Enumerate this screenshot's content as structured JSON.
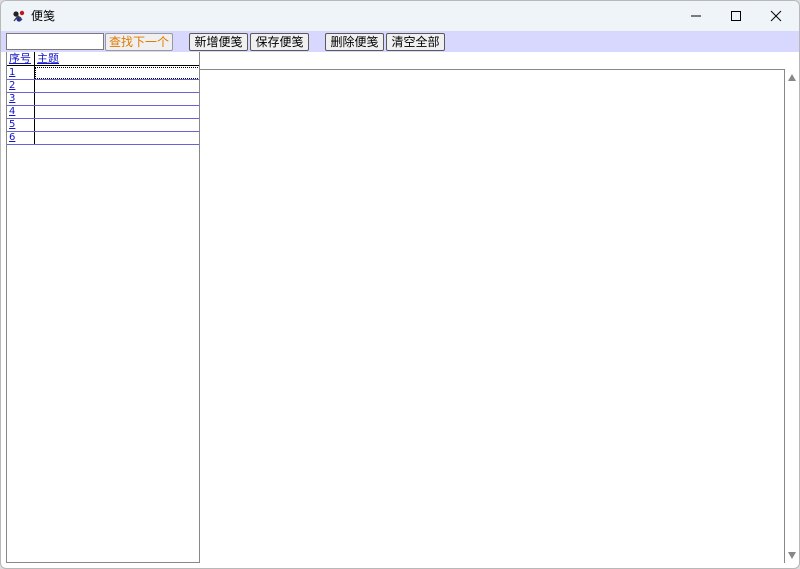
{
  "window": {
    "title": "便笺",
    "icon": "app-notes-icon",
    "controls": [
      "minimize-icon",
      "maximize-icon",
      "close-icon"
    ]
  },
  "toolbar": {
    "search_value": "",
    "find_next_label": "查找下一个",
    "new_note_label": "新增便笺",
    "save_note_label": "保存便笺",
    "delete_note_label": "删除便笺",
    "clear_all_label": "清空全部"
  },
  "note_list": {
    "columns": [
      "序号",
      "主题"
    ],
    "rows": [
      {
        "index": "1",
        "subject": ""
      },
      {
        "index": "2",
        "subject": ""
      },
      {
        "index": "3",
        "subject": ""
      },
      {
        "index": "4",
        "subject": ""
      },
      {
        "index": "5",
        "subject": ""
      },
      {
        "index": "6",
        "subject": ""
      }
    ],
    "selected_row": 1
  },
  "editor": {
    "content": ""
  },
  "colors": {
    "toolbar_bg": "#d8d8ff",
    "find_button_text": "#e07a00",
    "header_link": "#1414c8",
    "row_border": "#6464d8",
    "titlebar_bg": "#eff4f9"
  }
}
